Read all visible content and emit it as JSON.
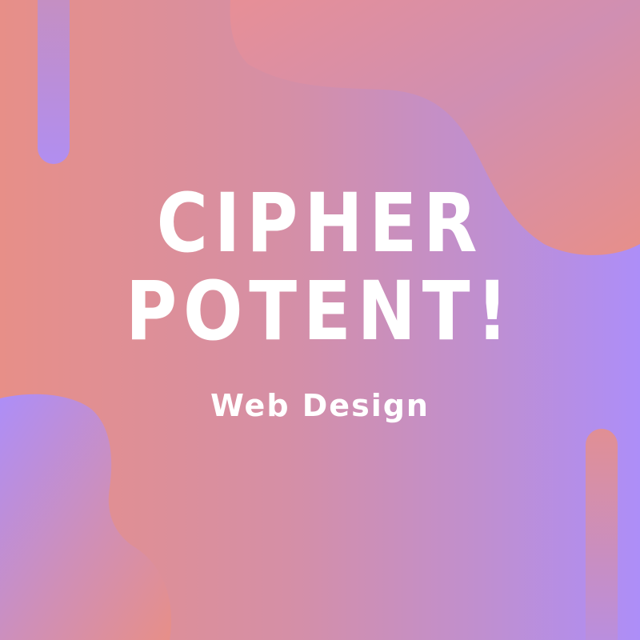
{
  "title": {
    "line1": "CIPHER",
    "line2": "POTENT!"
  },
  "subtitle": "Web Design",
  "colors": {
    "background_left": "#e78f88",
    "background_right": "#ad8ef8",
    "text": "#ffffff"
  }
}
